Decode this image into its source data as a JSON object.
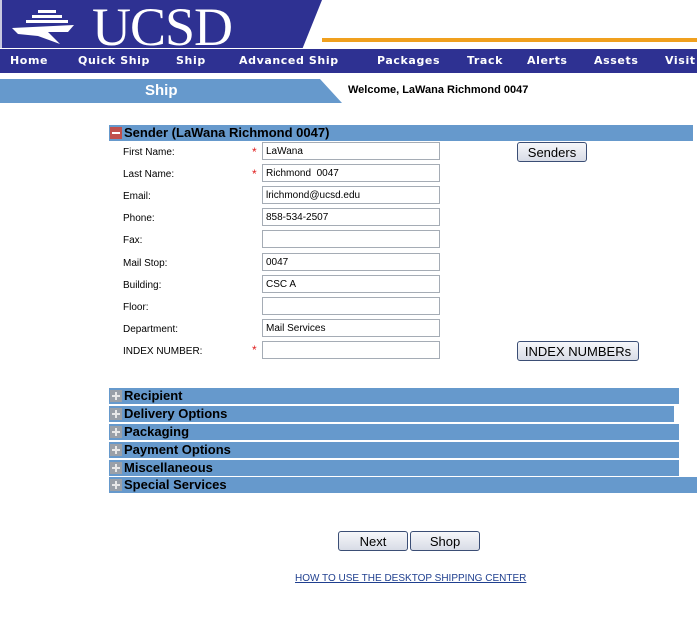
{
  "logo": {
    "text": "UCSD",
    "icon": "ship-logo-icon"
  },
  "nav": {
    "items": [
      {
        "label": "Home"
      },
      {
        "label": "Quick Ship"
      },
      {
        "label": "Ship"
      },
      {
        "label": "Advanced Ship"
      },
      {
        "label": "Packages"
      },
      {
        "label": "Track"
      },
      {
        "label": "Alerts"
      },
      {
        "label": "Assets"
      },
      {
        "label": "Visit"
      }
    ]
  },
  "subbar": {
    "title": "Ship",
    "welcome": "Welcome, LaWana Richmond 0047"
  },
  "sender": {
    "header": "Sender  (LaWana Richmond 0047)",
    "expanded": true,
    "fields": [
      {
        "label": "First Name:",
        "required": true,
        "value": "LaWana"
      },
      {
        "label": "Last Name:",
        "required": true,
        "value": "Richmond  0047"
      },
      {
        "label": "Email:",
        "required": false,
        "value": "lrichmond@ucsd.edu"
      },
      {
        "label": "Phone:",
        "required": false,
        "value": "858-534-2507"
      },
      {
        "label": "Fax:",
        "required": false,
        "value": ""
      },
      {
        "label": "Mail Stop:",
        "required": false,
        "value": "0047"
      },
      {
        "label": "Building:",
        "required": false,
        "value": "CSC A"
      },
      {
        "label": "Floor:",
        "required": false,
        "value": ""
      },
      {
        "label": "Department:",
        "required": false,
        "value": "Mail Services"
      },
      {
        "label": "INDEX NUMBER:",
        "required": true,
        "value": ""
      }
    ],
    "required_marker": "*",
    "senders_button": "Senders",
    "index_button": "INDEX NUMBERs"
  },
  "sections": [
    {
      "label": "Recipient",
      "expanded": false
    },
    {
      "label": "Delivery Options",
      "expanded": false
    },
    {
      "label": "Packaging",
      "expanded": false
    },
    {
      "label": "Payment Options",
      "expanded": false
    },
    {
      "label": "Miscellaneous",
      "expanded": false
    },
    {
      "label": "Special Services",
      "expanded": false
    }
  ],
  "actions": {
    "next": "Next",
    "shop": "Shop"
  },
  "help_link": "HOW TO USE THE DESKTOP SHIPPING CENTER",
  "colors": {
    "brand_navy": "#2e3192",
    "accent_orange": "#f0a01e",
    "section_blue": "#6699cc",
    "required_red": "#e02020"
  }
}
